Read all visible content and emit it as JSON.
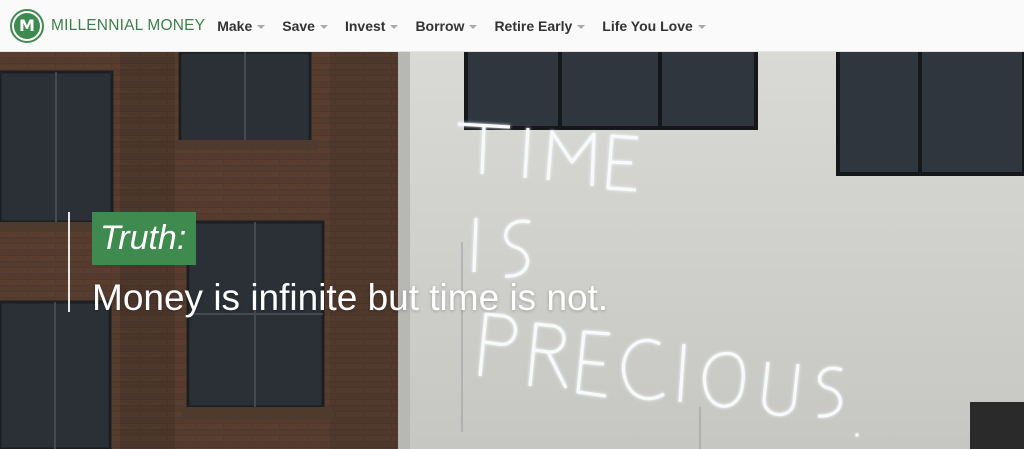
{
  "site": {
    "logo_letter": "M",
    "name": "MILLENNIAL MONEY",
    "brand_color": "#3f8a4f"
  },
  "nav": {
    "items": [
      {
        "label": "Make"
      },
      {
        "label": "Save"
      },
      {
        "label": "Invest"
      },
      {
        "label": "Borrow"
      },
      {
        "label": "Retire Early"
      },
      {
        "label": "Life You Love"
      }
    ]
  },
  "hero": {
    "label": "Truth:",
    "headline": "Money is infinite but time is not.",
    "sign_lines": [
      "TIME",
      "IS",
      "PRECIOUS."
    ]
  }
}
